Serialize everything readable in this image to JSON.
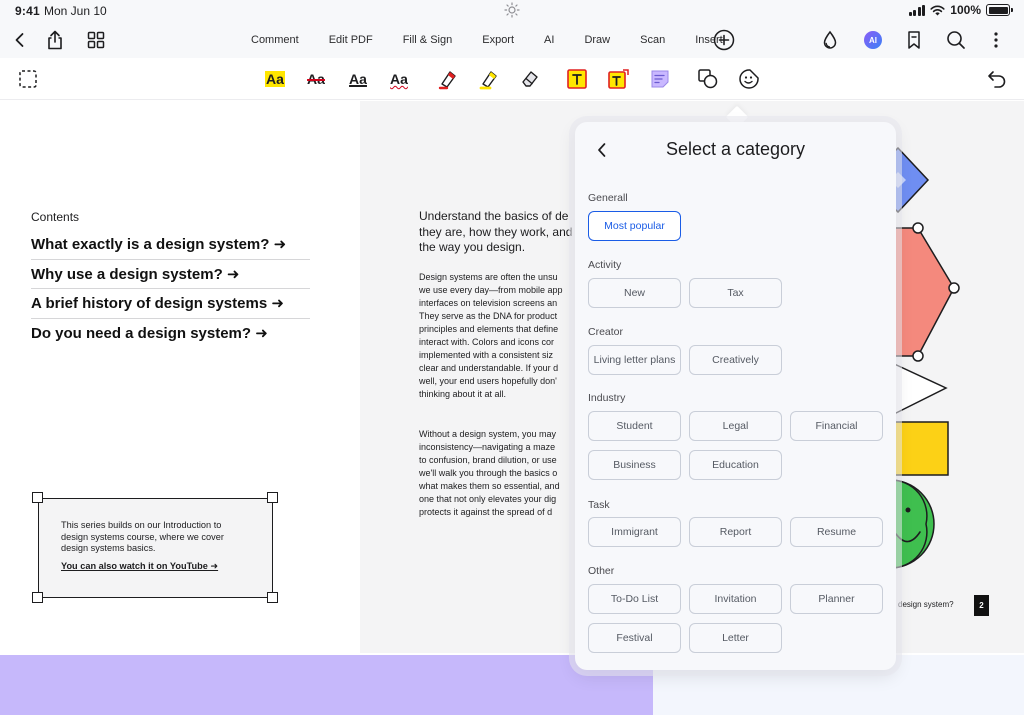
{
  "status_bar": {
    "time": "9:41",
    "date": "Mon Jun 10",
    "battery": "100%",
    "battery_level": 1.0
  },
  "nav": {
    "tabs": [
      {
        "label": "Comment",
        "active": true
      },
      {
        "label": "Edit PDF",
        "active": false
      },
      {
        "label": "Fill & Sign",
        "active": false
      },
      {
        "label": "Export",
        "active": false
      },
      {
        "label": "AI",
        "active": false
      },
      {
        "label": "Draw",
        "active": false
      },
      {
        "label": "Scan",
        "active": false
      },
      {
        "label": "Insert",
        "active": false
      }
    ],
    "ai_badge": "AI",
    "accent_color": "#1a5ce6"
  },
  "toolbar": {
    "text_styles": [
      "Aa",
      "Aa",
      "Aa",
      "Aa"
    ],
    "icons": [
      "select-region-icon",
      "highlight-text-icon",
      "strikethrough-text-icon",
      "underline-text-icon",
      "squiggly-text-icon",
      "marker-icon",
      "highlighter-icon",
      "eraser-icon",
      "text-box-icon",
      "text-callout-icon",
      "sticky-note-icon",
      "shapes-icon",
      "sticker-icon",
      "undo-icon"
    ]
  },
  "document": {
    "contents_title": "Contents",
    "toc": [
      "What exactly is a design system? ➜",
      "Why use a design system? ➜",
      "A brief history of design systems ➜",
      "Do you need a design system? ➜"
    ],
    "note_text": "This series builds on our Introduction to design systems course, where we cover design systems basics.",
    "note_link": "You can also watch it on YouTube ➜",
    "intro": [
      "Understand the basics of de",
      "they are, how they work, and",
      "the way you design."
    ],
    "paragraph1": [
      "Design systems are often the unsu",
      "we use every day—from mobile app",
      "interfaces on television screens an",
      "They serve as the DNA for product",
      "principles and elements that define",
      "interact with. Colors and icons cor",
      "implemented with a consistent siz",
      "clear and understandable. If your d",
      "well, your end users hopefully don'",
      "thinking about it at all."
    ],
    "paragraph2": [
      "Without a design system, you may",
      "inconsistency—navigating a maze",
      "to confusion, brand dilution, or use",
      "we'll walk you through the basics o",
      "what makes them so essential, and",
      "one that not only elevates your dig",
      "protects it against the spread of d"
    ],
    "footer_question": "design system?",
    "page_number": "2"
  },
  "popover": {
    "title": "Select a category",
    "sections": [
      {
        "label": "Generall",
        "items": [
          "Most popular"
        ],
        "selected": "Most popular"
      },
      {
        "label": "Activity",
        "items": [
          "New",
          "Tax"
        ]
      },
      {
        "label": "Creator",
        "items": [
          "Living letter plans",
          "Creatively"
        ]
      },
      {
        "label": "Industry",
        "items": [
          "Student",
          "Legal",
          "Financial",
          "Business",
          "Education"
        ]
      },
      {
        "label": "Task",
        "items": [
          "Immigrant",
          "Report",
          "Resume"
        ]
      },
      {
        "label": "Other",
        "items": [
          "To-Do List",
          "Invitation",
          "Planner",
          "Festival",
          "Letter"
        ]
      }
    ]
  }
}
